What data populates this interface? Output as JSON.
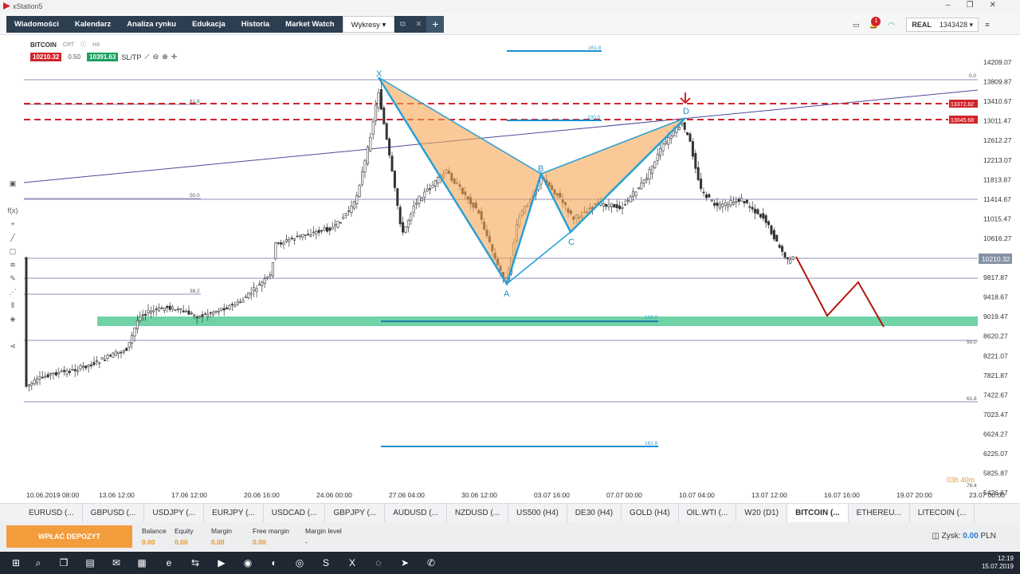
{
  "window": {
    "title": "xStation5"
  },
  "nav": {
    "items": [
      "Wiadomości",
      "Kalendarz",
      "Analiza rynku",
      "Edukacja",
      "Historia",
      "Market Watch"
    ],
    "active_tab": "Wykresy",
    "plus": "+"
  },
  "topright": {
    "badge": "1",
    "account_type": "REAL",
    "account_number": "1343428"
  },
  "symbol": {
    "name": "BITCOIN",
    "tag": "CRT",
    "timeframe": "H4",
    "sell": "10210.32",
    "spread": "0.50",
    "buy": "10391.63",
    "sltp": "SL/TP"
  },
  "chart_data": {
    "type": "candlestick",
    "y_ticks": [
      "14209.07",
      "13809.87",
      "13410.67",
      "13011.47",
      "12612.27",
      "12213.07",
      "11813.87",
      "11414.67",
      "11015.47",
      "10616.27",
      "10210.32",
      "9817.87",
      "9418.67",
      "9019.47",
      "8620.27",
      "8221.07",
      "7821.87",
      "7422.67",
      "7023.47",
      "6624.27",
      "6225.07",
      "5825.87",
      "5426.67"
    ],
    "x_ticks": [
      "10.06.2019 08:00",
      "13.06 12:00",
      "17.06 12:00",
      "20.06 16:00",
      "24.06 00:00",
      "27.06 04:00",
      "30.06 12:00",
      "03.07 16:00",
      "07.07 00:00",
      "10.07 04:00",
      "13.07 12:00",
      "16.07 16:00",
      "19.07 20:00",
      "23.07 00:00"
    ],
    "current_price": "10210.32",
    "sell_line_1": "13372.82",
    "sell_line_2": "13045.68",
    "fib_labels": [
      "0.0",
      "61.8",
      "50.0",
      "38.2",
      "50.0",
      "61.8",
      "76.4",
      "100.0",
      "161.8",
      "100.0",
      "161.8"
    ],
    "pattern_points": [
      "X",
      "A",
      "B",
      "C",
      "D"
    ],
    "countdown": "03h 40m",
    "notes": "Bullish/bearish harmonic (bat) pattern X-A-B-C-D with projected zigzag"
  },
  "tabs": [
    "EURUSD (...",
    "GBPUSD (...",
    "USDJPY (...",
    "EURJPY (...",
    "USDCAD (...",
    "GBPJPY (...",
    "AUDUSD (...",
    "NZDUSD (...",
    "US500 (H4)",
    "DE30 (H4)",
    "GOLD (H4)",
    "OIL.WTI (...",
    "W20 (D1)",
    "BITCOIN (...",
    "ETHEREU...",
    "LITECOIN (..."
  ],
  "account": {
    "deposit_label": "WPŁAĆ DEPOZYT",
    "balance_label": "Balance",
    "balance": "0.00",
    "equity_label": "Equity",
    "equity": "0.00",
    "margin_label": "Margin",
    "margin": "0.00",
    "free_margin_label": "Free margin",
    "free_margin": "0.00",
    "margin_level_label": "Margin level",
    "margin_level": "-",
    "profit_label": "Zysk:",
    "profit": "0.00",
    "profit_currency": "PLN"
  },
  "clock": {
    "time": "12:19",
    "date": "15.07.2019"
  }
}
